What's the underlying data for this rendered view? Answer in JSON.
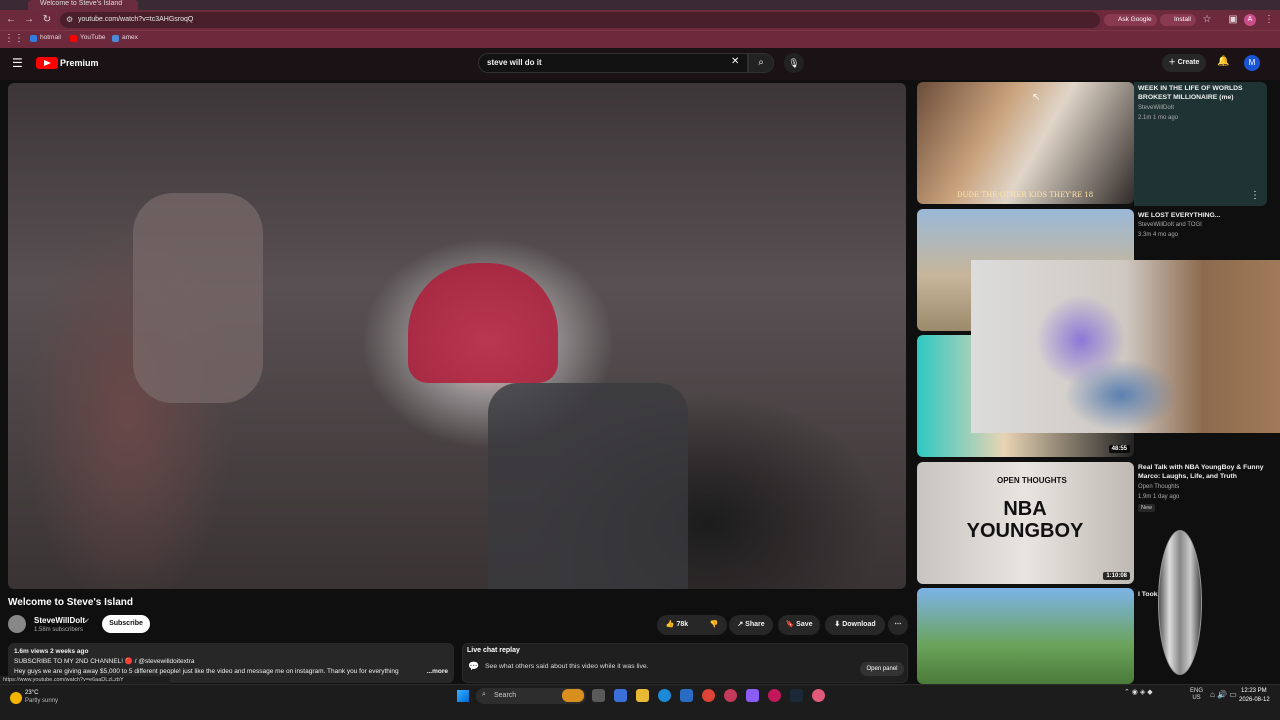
{
  "browser": {
    "tab_title": "Welcome to Steve's Island",
    "url": "youtube.com/watch?v=tc3AHGsroqQ",
    "ask_google": "Ask Google",
    "install": "Install",
    "profile_initial": "A",
    "bookmarks": [
      {
        "label": "hotmail",
        "color": "#2f7de1"
      },
      {
        "label": "YouTube",
        "color": "#ff0000"
      },
      {
        "label": "amex",
        "color": "#4b8ad8"
      }
    ]
  },
  "header": {
    "logo_text": "Premium",
    "search_query": "steve will do it",
    "create_label": "Create",
    "avatar_initial": "M"
  },
  "video": {
    "title": "Welcome to Steve's Island",
    "channel": "SteveWillDoIt",
    "subscribers": "1.58m subscribers",
    "subscribe_label": "Subscribe",
    "likes": "78k",
    "share_label": "Share",
    "save_label": "Save",
    "download_label": "Download"
  },
  "description": {
    "meta": "1.6m views  2 weeks ago",
    "line1": "SUBSCRIBE TO MY 2ND CHANNEL! 🔴 / @stevewilldoitextra",
    "line2": "Hey guys we are giving away $5,000 to 5 different people! just like the video and message me on instagram. Thank you for everything",
    "more": "...more"
  },
  "live_chat": {
    "title": "Live chat replay",
    "subtitle": "See what others said about this video while it was live.",
    "button": "Open panel"
  },
  "status_url": "https://www.youtube.com/watch?v=e6aaDLzLzbY",
  "recommendations": [
    {
      "title": "WEEK IN THE LIFE OF WORLDS BROKEST MILLIONAIRE (me)",
      "channel": "SteveWillDoIt",
      "meta": "2.1m  1 mo ago",
      "thumb_text": "DUDE THE OTHER KIDS THEY'RE 18"
    },
    {
      "title": "WE LOST EVERYTHING...",
      "channel": "SteveWillDoIt and TOGI",
      "meta": "3.3m  4 mo ago"
    },
    {
      "title": "",
      "channel": "",
      "meta": "",
      "duration": "48:55"
    },
    {
      "title": "Real Talk with NBA YoungBoy & Funny Marco: Laughs, Life, and Truth",
      "channel": "Open Thoughts",
      "meta": "1.9m  1 day ago",
      "badge": "New",
      "duration": "1:10:08",
      "thumb_text": "NBA YOUNGBOY",
      "thumb_small": "OPEN THOUGHTS"
    },
    {
      "title": "I Took ... World!",
      "channel": "",
      "meta": ""
    }
  ],
  "taskbar": {
    "temperature": "23°C",
    "weather": "Partly sunny",
    "search_label": "Search",
    "lang_top": "ENG",
    "lang_bottom": "US",
    "time": "12:23 PM",
    "date": "2026-08-12"
  }
}
